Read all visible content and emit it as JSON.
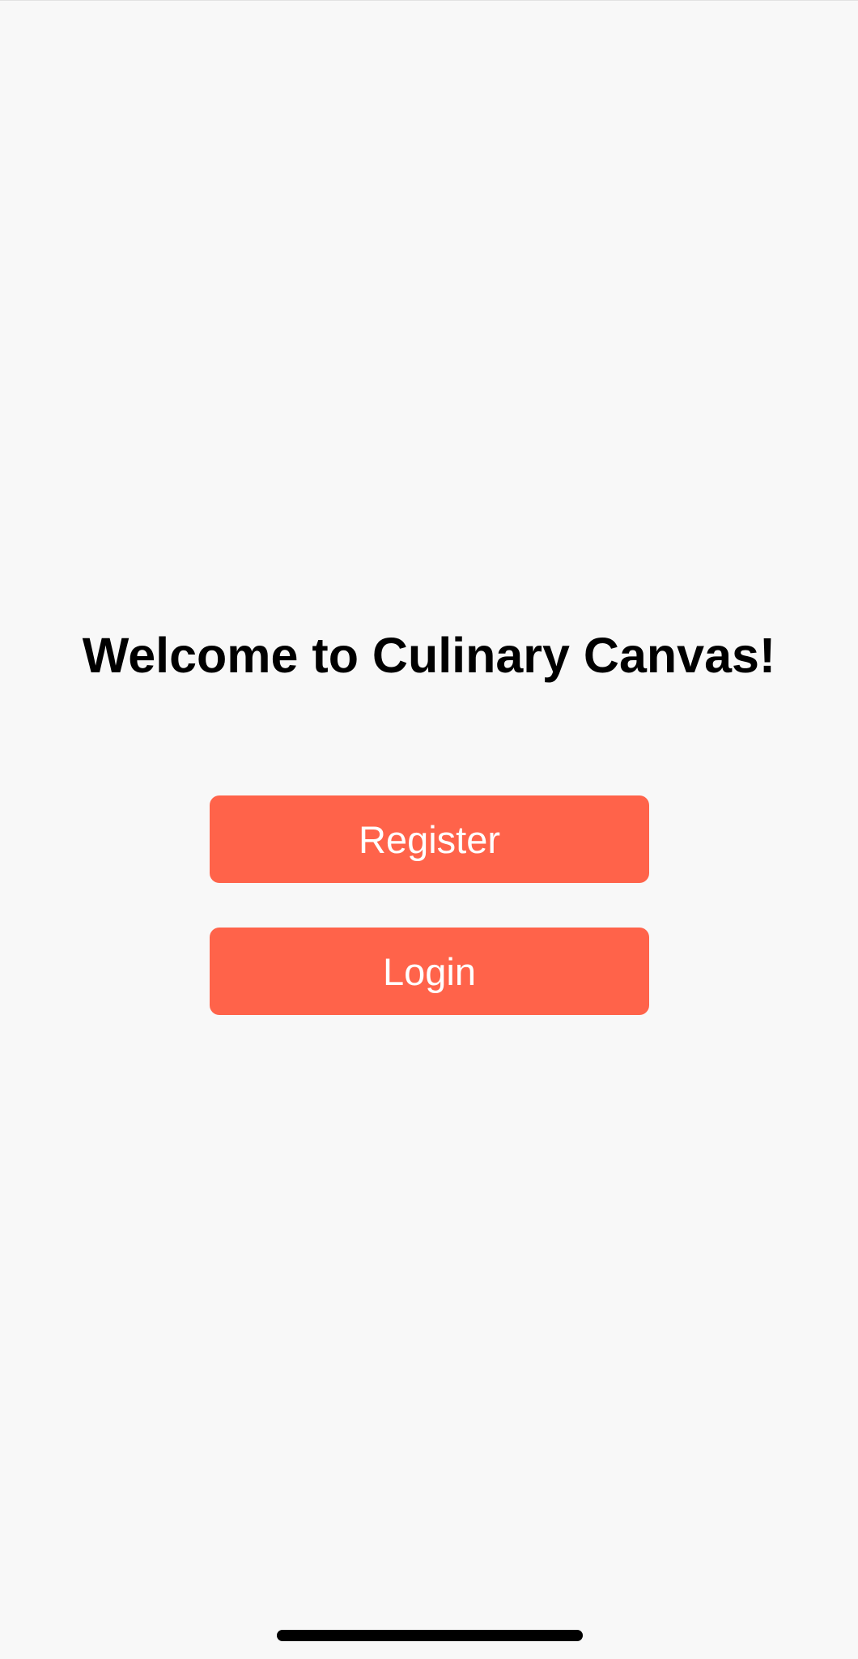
{
  "welcome": {
    "title": "Welcome to Culinary Canvas!"
  },
  "actions": {
    "register_label": "Register",
    "login_label": "Login"
  },
  "colors": {
    "background": "#f8f8f8",
    "accent": "#ff634a",
    "button_text": "#ffffff",
    "title_text": "#000000"
  }
}
